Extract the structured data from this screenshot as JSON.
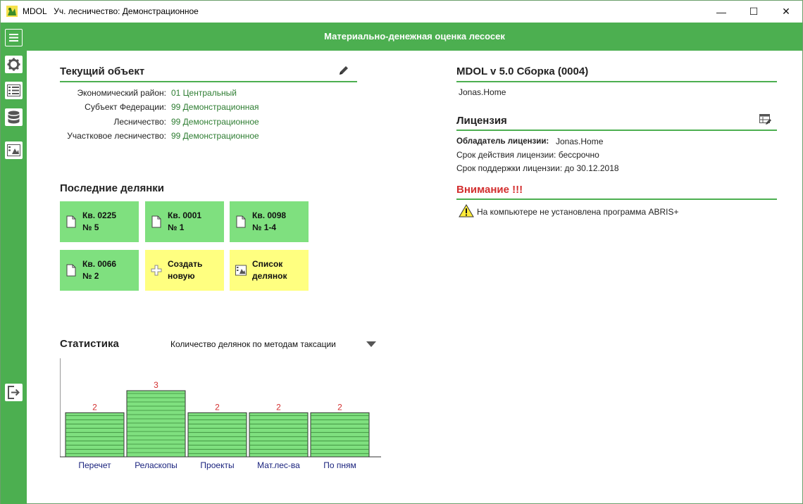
{
  "window": {
    "app_name": "MDOL",
    "title": "Уч. лесничество: Демонстрационное",
    "minimize_glyph": "—",
    "maximize_glyph": "☐",
    "close_glyph": "✕"
  },
  "header": {
    "title": "Материально-денежная оценка лесосек"
  },
  "sidebar": {
    "items": [
      {
        "icon": "menu-icon"
      },
      {
        "icon": "gear-icon"
      },
      {
        "icon": "list-icon"
      },
      {
        "icon": "database-icon"
      },
      {
        "icon": "image-list-icon"
      },
      {
        "icon": "exit-icon"
      }
    ]
  },
  "current_object": {
    "title": "Текущий объект",
    "rows": [
      {
        "label": "Экономический район:",
        "value": "01 Центральный"
      },
      {
        "label": "Субъект Федерации:",
        "value": "99 Демонстрационная"
      },
      {
        "label": "Лесничество:",
        "value": "99 Демонстрационное"
      },
      {
        "label": "Участковое лесничество:",
        "value": "99 Демонстрационное"
      }
    ]
  },
  "recent": {
    "title": "Последние делянки",
    "tiles": [
      {
        "line1": "Кв. 0225",
        "line2": "№ 5",
        "kind": "doc"
      },
      {
        "line1": "Кв. 0001",
        "line2": "№ 1",
        "kind": "doc"
      },
      {
        "line1": "Кв. 0098",
        "line2": "№ 1-4",
        "kind": "doc"
      },
      {
        "line1": "Кв. 0066",
        "line2": "№ 2",
        "kind": "doc"
      },
      {
        "line1": "Создать",
        "line2": "новую",
        "kind": "create"
      },
      {
        "line1": "Список",
        "line2": "делянок",
        "kind": "list"
      }
    ]
  },
  "statistics": {
    "title": "Статистика",
    "selector": "Количество делянок по методам таксации"
  },
  "chart_data": {
    "type": "bar",
    "categories": [
      "Перечет",
      "Реласкопы",
      "Проекты",
      "Мат.лес-ва",
      "По пням"
    ],
    "values": [
      2,
      3,
      2,
      2,
      2
    ],
    "ylim": [
      0,
      3
    ],
    "colors": {
      "bar": "#7fe07f",
      "value_label": "#d32f2f",
      "category_label": "#1a237e"
    }
  },
  "version": {
    "title": "MDOL v 5.0 Сборка (0004)",
    "machine": "Jonas.Home"
  },
  "license": {
    "title": "Лицензия",
    "owner_label": "Обладатель лицензии:",
    "owner_value": "Jonas.Home",
    "validity": "Срок действия лицензии: бессрочно",
    "support": "Срок поддержки лицензии: до 30.12.2018"
  },
  "warning": {
    "title": "Внимание !!!",
    "message": "На компьютере не установлена программа ABRIS+"
  },
  "colors": {
    "accent": "#4caf50",
    "tile_green": "#7fe07f",
    "tile_yellow": "#ffff80",
    "warning_red": "#d32f2f",
    "value_green": "#2e7d32"
  }
}
